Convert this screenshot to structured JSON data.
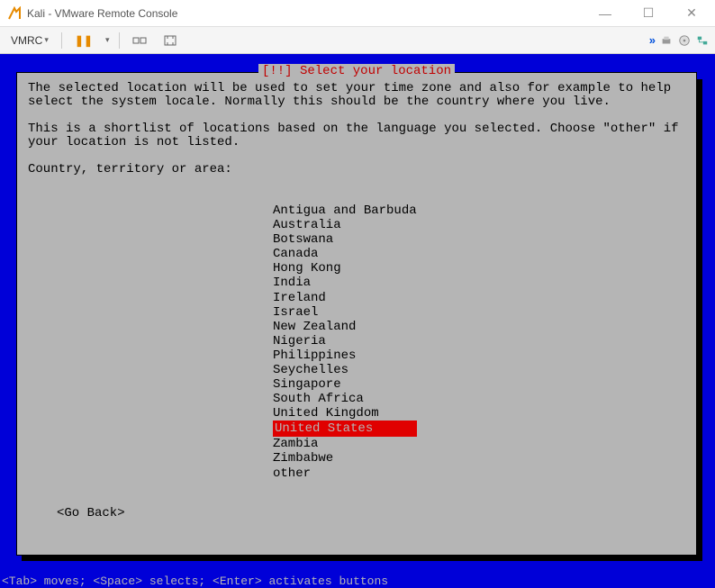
{
  "window": {
    "title": "Kali - VMware Remote Console",
    "controls": {
      "minimize": "—",
      "maximize": "☐",
      "close": "✕"
    }
  },
  "toolbar": {
    "vmrc_label": "VMRC",
    "pause_glyph": "❚❚",
    "right_arrows": "»"
  },
  "installer": {
    "header": "[!!] Select your location",
    "para1": "The selected location will be used to set your time zone and also for example to help select the system locale. Normally this should be the country where you live.",
    "para2": "This is a shortlist of locations based on the language you selected. Choose \"other\" if your location is not listed.",
    "prompt": "Country, territory or area:",
    "locations": [
      "Antigua and Barbuda",
      "Australia",
      "Botswana",
      "Canada",
      "Hong Kong",
      "India",
      "Ireland",
      "Israel",
      "New Zealand",
      "Nigeria",
      "Philippines",
      "Seychelles",
      "Singapore",
      "South Africa",
      "United Kingdom",
      "United States",
      "Zambia",
      "Zimbabwe",
      "other"
    ],
    "selected_index": 15,
    "go_back": "<Go Back>"
  },
  "hint": "<Tab> moves; <Space> selects; <Enter> activates buttons"
}
